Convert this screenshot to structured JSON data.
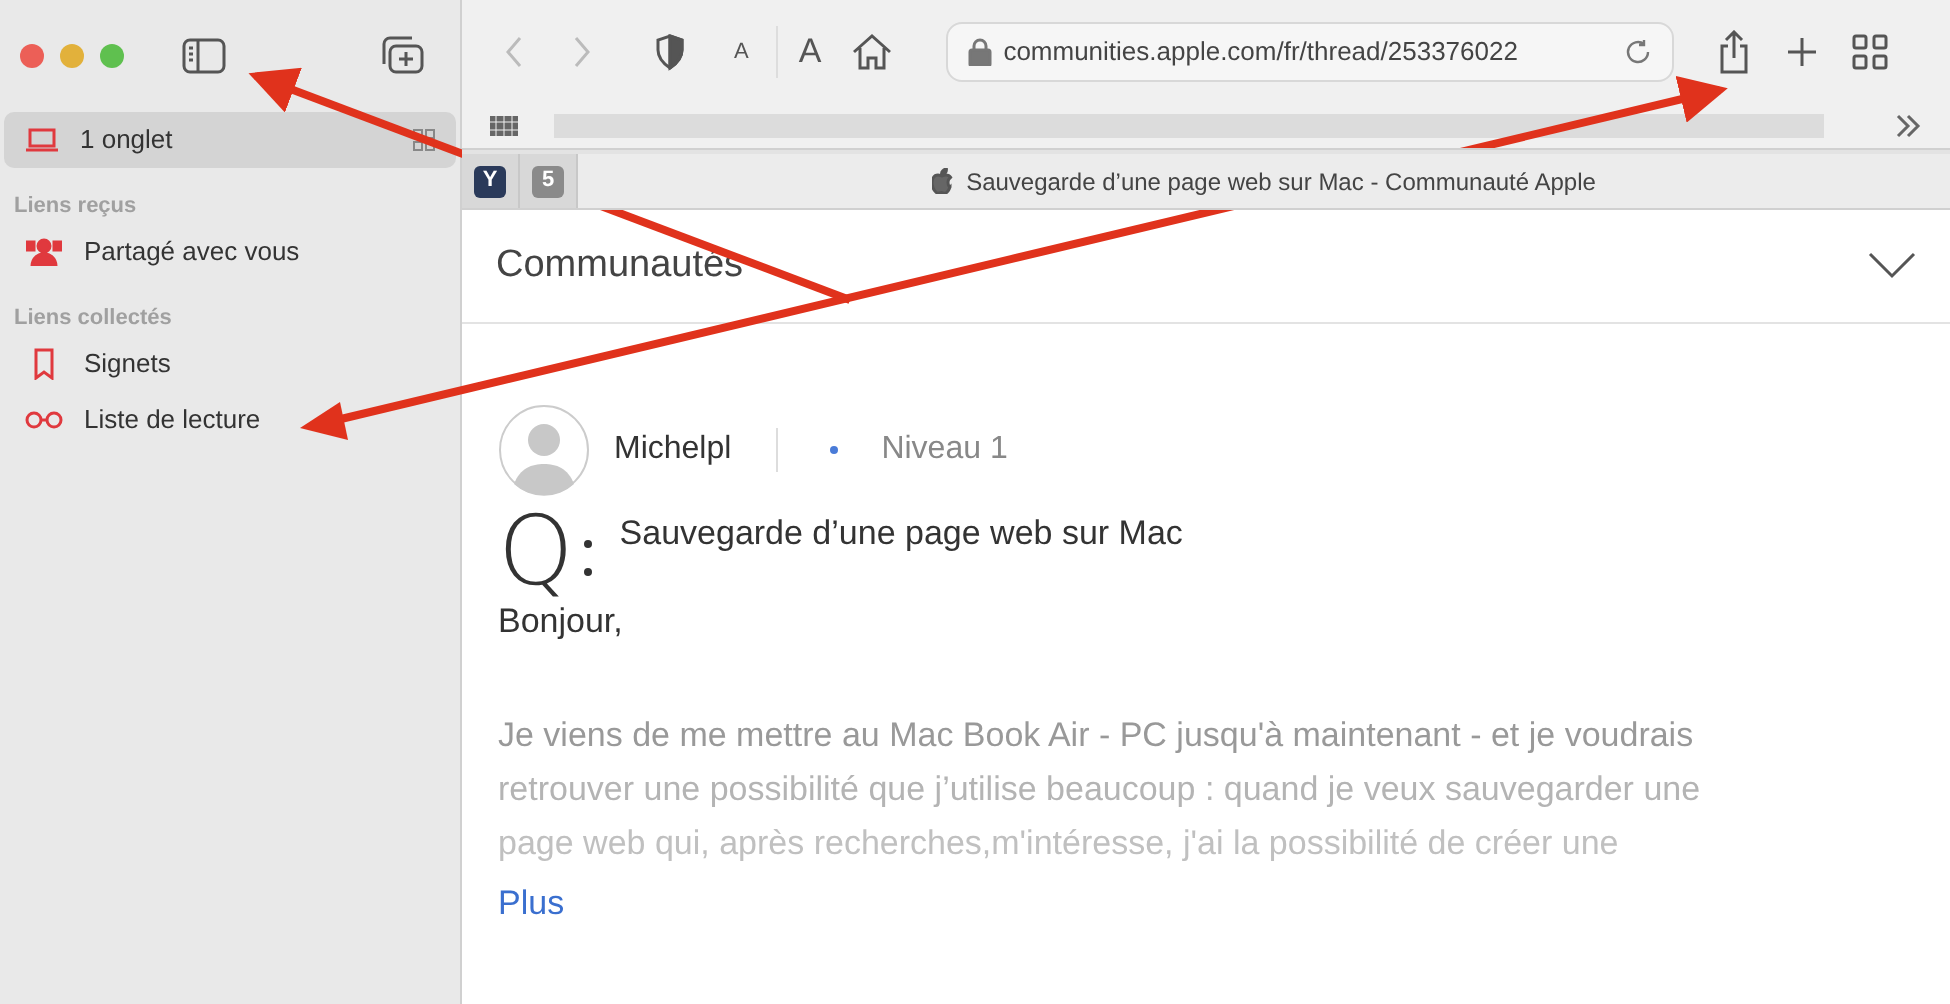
{
  "sidebar": {
    "tab_item": {
      "label": "1 onglet",
      "selected": true
    },
    "sections": [
      {
        "heading": "Liens reçus",
        "items": [
          {
            "label": "Partagé avec vous",
            "kind": "shared"
          }
        ]
      },
      {
        "heading": "Liens collectés",
        "items": [
          {
            "label": "Signets",
            "kind": "bookmark"
          },
          {
            "label": "Liste de lecture",
            "kind": "reading"
          }
        ]
      }
    ]
  },
  "toolbar": {
    "text_small": "A",
    "text_large": "A",
    "address": "communities.apple.com/fr/thread/253376022"
  },
  "tabs": [
    {
      "label": "Y",
      "kind": "favicon",
      "selected": false
    },
    {
      "label": "5",
      "kind": "favicon",
      "selected": false
    },
    {
      "label": "Sauvegarde d’une page web sur Mac - Communauté Apple",
      "kind": "page",
      "selected": true
    }
  ],
  "page": {
    "site_title": "Communautés",
    "author": "Michelpl",
    "level_label": "Niveau 1",
    "q_mark": "Q",
    "question_title": "Sauvegarde d’une page web sur Mac",
    "greeting": "Bonjour,",
    "body_lines": [
      "Je viens de me mettre au Mac Book Air - PC jusqu'à maintenant - et je voudrais",
      "retrouver une possibilité que j’utilise beaucoup : quand je veux sauvegarder une",
      "page web qui, après recherches,m'intéresse,  j'ai la possibilité de créer une"
    ],
    "more_link": "Plus"
  }
}
